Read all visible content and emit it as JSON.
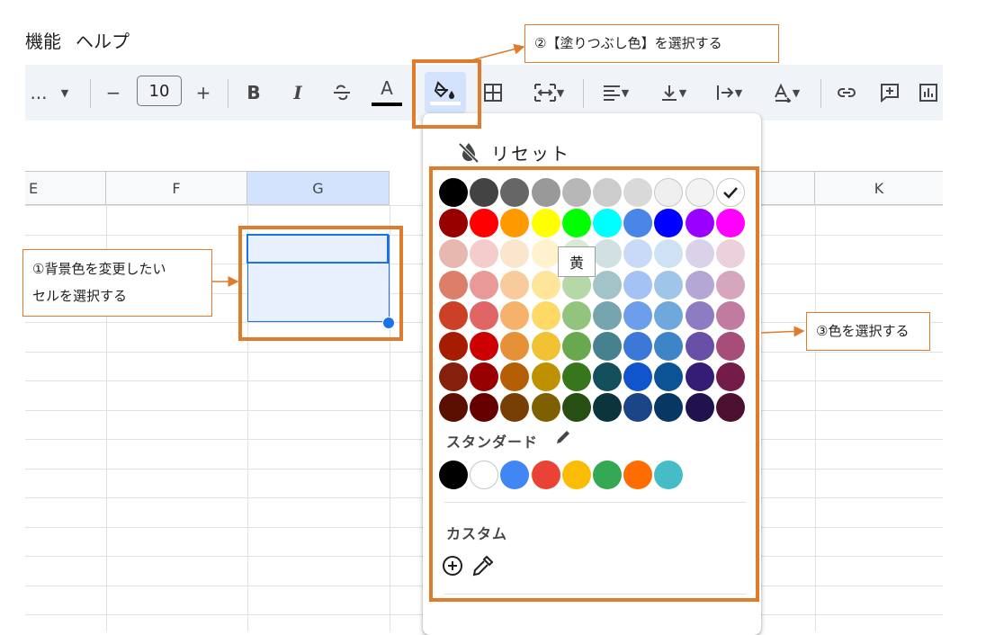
{
  "menu": {
    "items": [
      "機能",
      "ヘルプ"
    ]
  },
  "toolbar": {
    "ellipsis": "...",
    "minus": "−",
    "font_size": "10",
    "plus": "+",
    "bold": "B",
    "italic": "I",
    "text_color_letter": "A"
  },
  "columns": [
    "E",
    "F",
    "G",
    "K"
  ],
  "color_picker": {
    "reset_label": "リセット",
    "tooltip": "黄",
    "standard_label": "スタンダード",
    "custom_label": "カスタム",
    "palette_rows": [
      [
        "#000000",
        "#434343",
        "#666666",
        "#999999",
        "#b7b7b7",
        "#cccccc",
        "#d9d9d9",
        "#efefef",
        "#f3f3f3",
        "#ffffff"
      ],
      [
        "#980000",
        "#ff0000",
        "#ff9900",
        "#ffff00",
        "#00ff00",
        "#00ffff",
        "#4a86e8",
        "#0000ff",
        "#9900ff",
        "#ff00ff"
      ],
      [
        "#e6b8af",
        "#f4cccc",
        "#fce5cd",
        "#fff2cc",
        "#d9ead3",
        "#d0e0e3",
        "#c9daf8",
        "#cfe2f3",
        "#d9d2e9",
        "#ead1dc"
      ],
      [
        "#dd7e6b",
        "#ea9999",
        "#f9cb9c",
        "#ffe599",
        "#b6d7a8",
        "#a2c4c9",
        "#a4c2f4",
        "#9fc5e8",
        "#b4a7d6",
        "#d5a6bd"
      ],
      [
        "#cc4125",
        "#e06666",
        "#f6b26b",
        "#ffd966",
        "#93c47d",
        "#76a5af",
        "#6d9eeb",
        "#6fa8dc",
        "#8e7cc3",
        "#c27ba0"
      ],
      [
        "#a61c00",
        "#cc0000",
        "#e69138",
        "#f1c232",
        "#6aa84f",
        "#45818e",
        "#3c78d8",
        "#3d85c6",
        "#674ea7",
        "#a64d79"
      ],
      [
        "#85200c",
        "#990000",
        "#b45f06",
        "#bf9000",
        "#38761d",
        "#134f5c",
        "#1155cc",
        "#0b5394",
        "#351c75",
        "#741b47"
      ],
      [
        "#5b0f00",
        "#660000",
        "#783f04",
        "#7f6000",
        "#274e13",
        "#0c343d",
        "#1c4587",
        "#073763",
        "#20124d",
        "#4c1130"
      ]
    ],
    "standard_colors": [
      "#000000",
      "#ffffff",
      "#4285f4",
      "#ea4335",
      "#fbbc04",
      "#34a853",
      "#ff6d01",
      "#46bdc6"
    ]
  },
  "annotations": {
    "step1": [
      "①背景色を変更したい",
      "セルを選択する"
    ],
    "step2": "②【塗りつぶし色】を選択する",
    "step3": "③色を選択する"
  },
  "colors": {
    "accent": "#e07b2c",
    "selection_fill": "#e8f0fe",
    "selection_border": "#1a73e8",
    "toolbar_bg": "#f0f4f9"
  }
}
